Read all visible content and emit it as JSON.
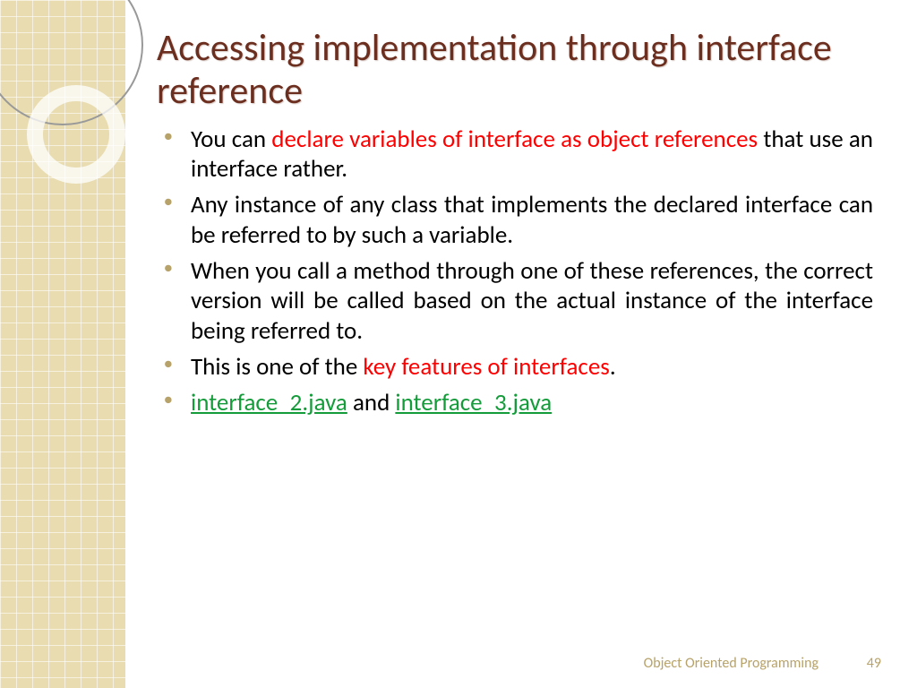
{
  "title": "Accessing implementation through interface reference",
  "bullets": [
    {
      "parts": [
        {
          "text": "You can ",
          "cls": ""
        },
        {
          "text": "declare variables of interface as object references",
          "cls": "red"
        },
        {
          "text": " that use an interface rather.",
          "cls": ""
        }
      ]
    },
    {
      "parts": [
        {
          "text": "Any instance of any class that implements the declared interface can be referred to by such a variable.",
          "cls": ""
        }
      ]
    },
    {
      "parts": [
        {
          "text": "When you call a method through one of these references, the correct version will be called based on the actual instance of the interface being referred to.",
          "cls": ""
        }
      ]
    },
    {
      "parts": [
        {
          "text": "This is one of the ",
          "cls": ""
        },
        {
          "text": "key features of interfaces",
          "cls": "red"
        },
        {
          "text": ".",
          "cls": ""
        }
      ]
    },
    {
      "parts": [
        {
          "text": "interface_2.java",
          "cls": "link"
        },
        {
          "text": " and ",
          "cls": ""
        },
        {
          "text": "interface_3.java",
          "cls": "link"
        }
      ]
    }
  ],
  "footer": "Object Oriented Programming",
  "page": "49"
}
